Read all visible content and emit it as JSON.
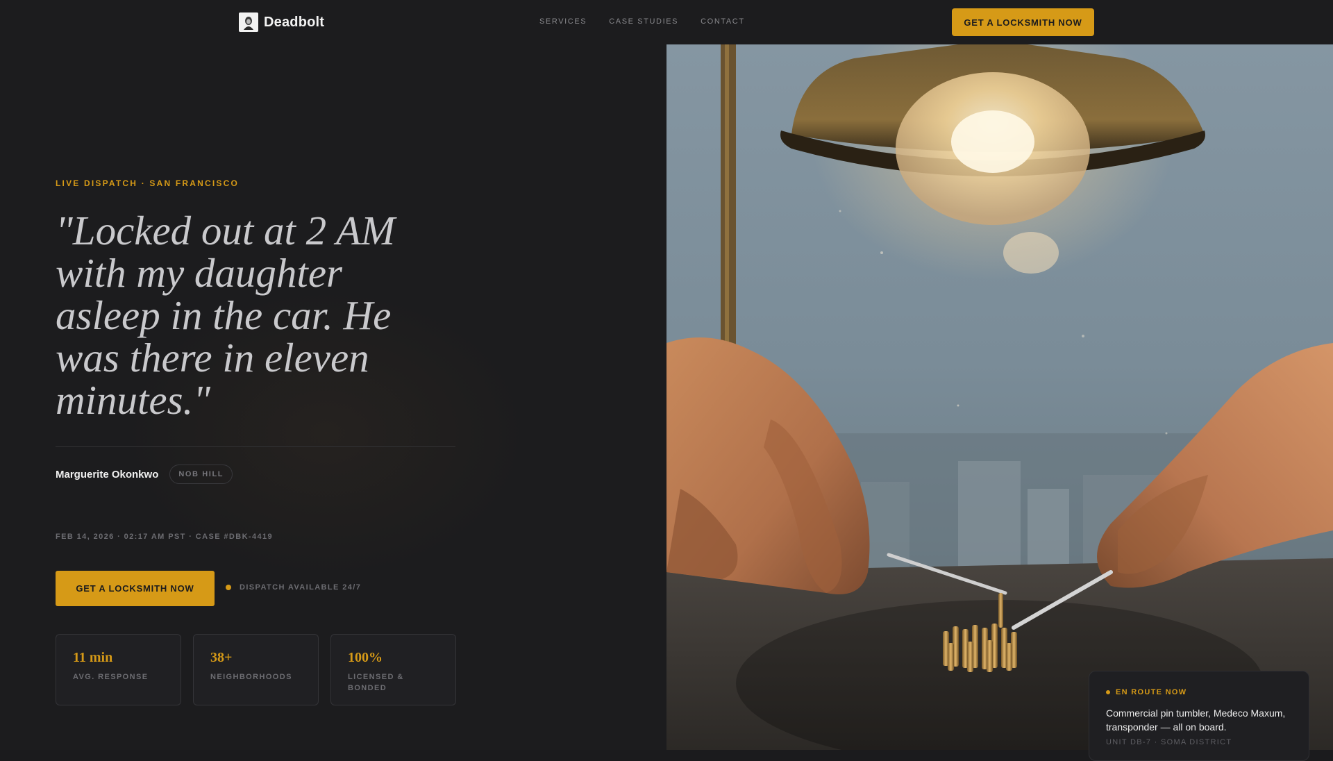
{
  "nav": {
    "brand": "Deadbolt",
    "links": [
      "SERVICES",
      "CASE STUDIES",
      "CONTACT"
    ],
    "cta": "GET A LOCKSMITH NOW"
  },
  "hero": {
    "eyebrow": "LIVE DISPATCH · SAN FRANCISCO",
    "quote": "\"Locked out at 2 AM with my daughter asleep in the car. He was there in eleven minutes.\"",
    "author": "Marguerite Okonkwo",
    "neighborhood": "NOB HILL",
    "meta": "FEB 14, 2026 · 02:17 AM PST · CASE #DBK-4419",
    "cta": "GET A LOCKSMITH NOW",
    "availability": "DISPATCH AVAILABLE 24/7"
  },
  "stats": [
    {
      "value": "11 min",
      "label": "AVG. RESPONSE"
    },
    {
      "value": "38+",
      "label": "NEIGHBORHOODS"
    },
    {
      "value": "100%",
      "label": "LICENSED & BONDED"
    }
  ],
  "status_card": {
    "title": "EN ROUTE NOW",
    "body": "Commercial pin tumbler, Medeco Maxum, transponder — all on board.",
    "unit": "UNIT DB-7 · SOMA DISTRICT"
  },
  "colors": {
    "accent": "#d69a17",
    "background": "#1c1c1e"
  },
  "icons": {
    "brand_logo": "locksmith-portrait-logo",
    "status_dot": "amber-dot"
  }
}
